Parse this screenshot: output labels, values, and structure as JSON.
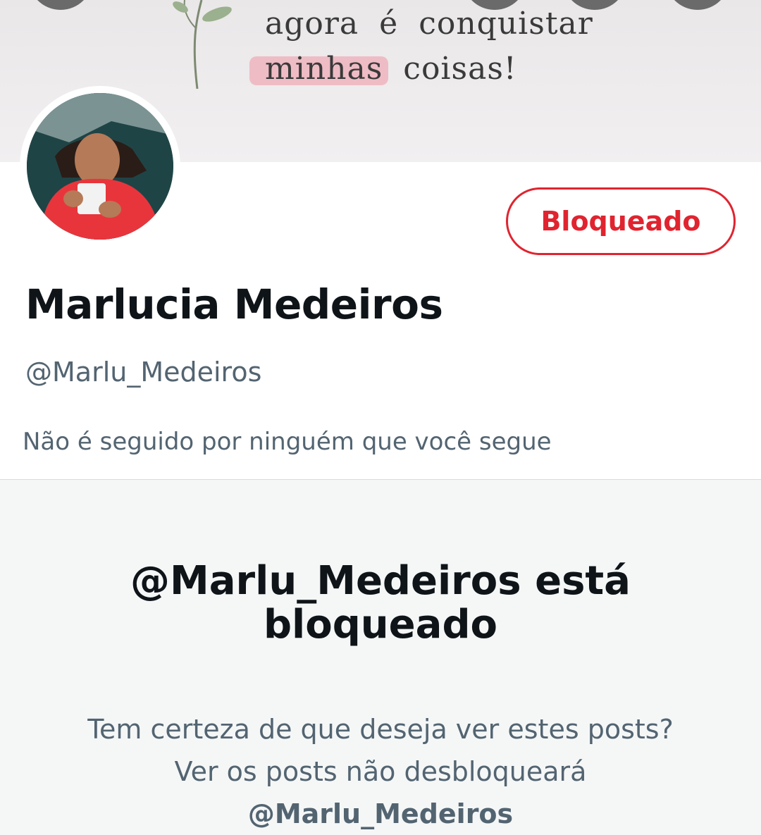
{
  "banner": {
    "line1_word1": "agora",
    "line1_word2": "é",
    "line1_word3": "conquistar",
    "line2_highlight": "minhas",
    "line2_rest": "coisas!"
  },
  "profile": {
    "display_name": "Marlucia Medeiros",
    "handle": "@Marlu_Medeiros",
    "followers_note": "Não é seguido por ninguém que você segue",
    "blocked_button_label": "Bloqueado"
  },
  "blocked_notice": {
    "title_line1": "@Marlu_Medeiros está",
    "title_line2": "bloqueado",
    "description": "Tem certeza de que deseja ver estes posts? Ver os posts não desbloqueará",
    "description_handle": "@Marlu_Medeiros"
  },
  "colors": {
    "accent_red": "#e0242f",
    "text_primary": "#0f1419",
    "text_secondary": "#536471"
  },
  "icons": [
    "back-button",
    "search-button",
    "share-button",
    "more-button"
  ]
}
